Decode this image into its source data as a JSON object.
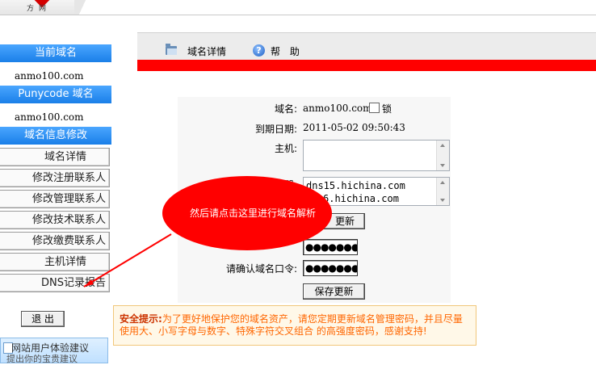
{
  "logo": {
    "text": "方网"
  },
  "sidebar": {
    "current_domain_head": "当前域名",
    "current_domain": "anmo100.com",
    "punycode_head": "Punycode 域名",
    "punycode": "anmo100.com",
    "modify_head": "域名信息修改",
    "items": [
      {
        "label": "域名详情"
      },
      {
        "label": "修改注册联系人"
      },
      {
        "label": "修改管理联系人"
      },
      {
        "label": "修改技术联系人"
      },
      {
        "label": "修改缴费联系人"
      },
      {
        "label": "主机详情"
      },
      {
        "label": "DNS记录报告"
      }
    ],
    "exit": "退 出",
    "feedback_title": "网站用户体验建议",
    "feedback_sub": "提出你的宝贵建议"
  },
  "toolbar": {
    "detail": "域名详情",
    "help": "帮 助"
  },
  "form": {
    "domain_label": "域名:",
    "domain_value": "anmo100.com",
    "lock_label": "锁",
    "expiry_label": "到期日期:",
    "expiry_value": "2011-05-02 09:50:43",
    "host_label": "主机:",
    "dns_label": "解析服务器:",
    "dns_visible_label": "服务器:",
    "dns_line1": "dns15.hichina.com",
    "dns_line2": "6.hichina.com",
    "update_btn_partial": "更新",
    "password_mask": "●●●●●●●●",
    "confirm_label": "请确认域名口令:",
    "confirm_mask": "●●●●●●●●",
    "save_btn": "保存更新"
  },
  "callout": {
    "text": "然后请点击这里进行域名解析"
  },
  "notice": {
    "title": "安全提示:",
    "body": "为了更好地保护您的域名资产，请您定期更新域名管理密码，并且尽量使用大、小写字母与数字、特殊字符交叉组合 的高强度密码，感谢支持!"
  },
  "colors": {
    "accent_blue": "#1a7fe8",
    "alert_red": "#ff0000",
    "notice_orange": "#ff6600"
  },
  "icons": [
    "folder-icon",
    "help-icon",
    "lock-checkbox",
    "feedback-icon"
  ]
}
